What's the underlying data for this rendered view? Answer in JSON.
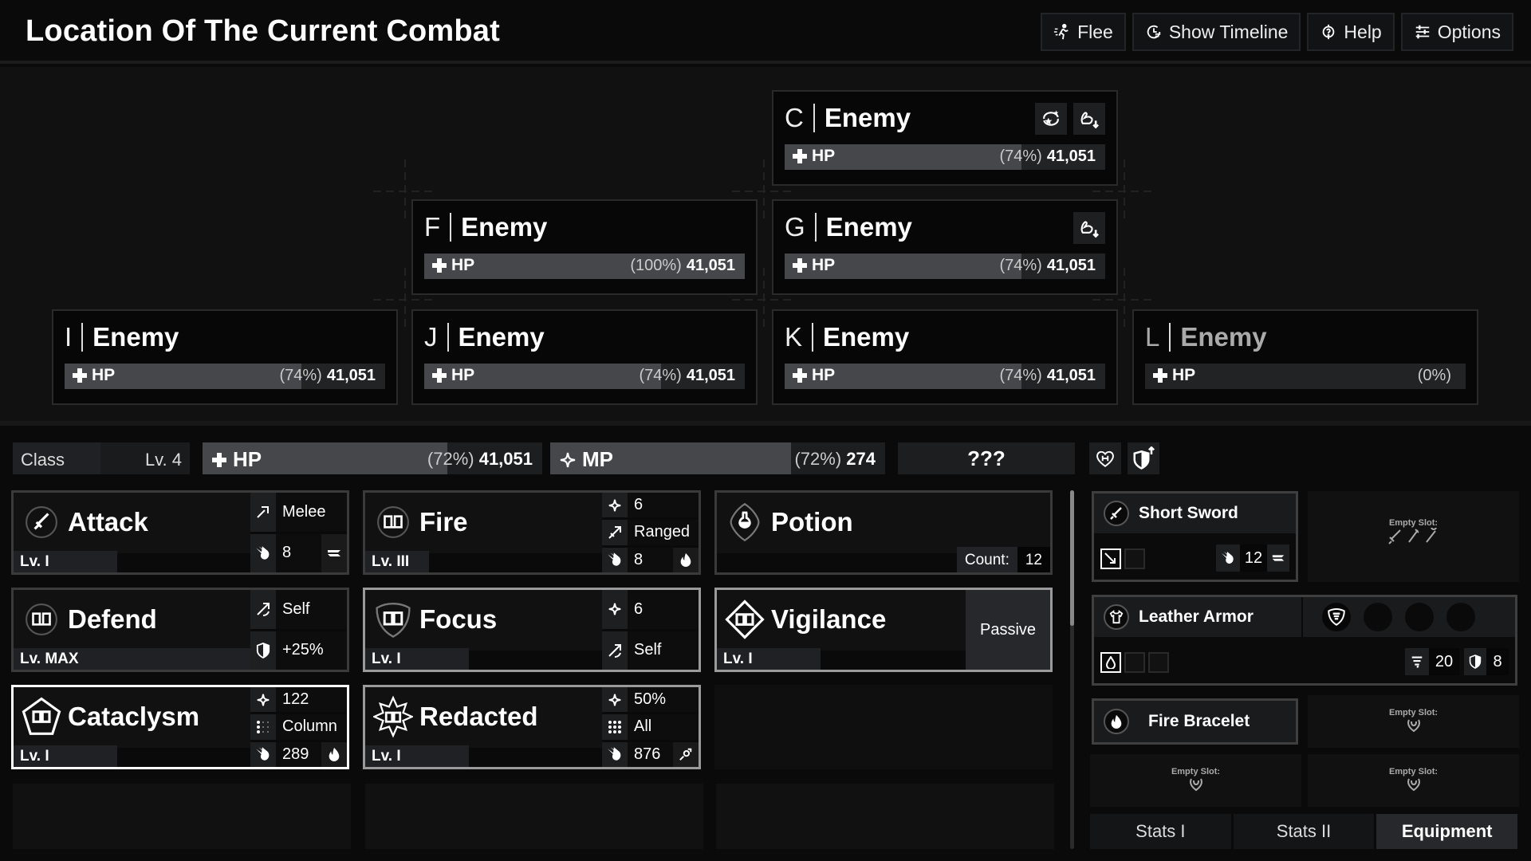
{
  "header": {
    "title": "Location Of The Current Combat",
    "buttons": [
      {
        "label": "Flee",
        "icon": "running-person-icon"
      },
      {
        "label": "Show Timeline",
        "icon": "timeline-clock-icon"
      },
      {
        "label": "Help",
        "icon": "help-icon"
      },
      {
        "label": "Options",
        "icon": "sliders-icon"
      }
    ]
  },
  "enemies": [
    {
      "letter": "C",
      "name": "Enemy",
      "hp_label": "HP",
      "hp_pct_text": "(74%)",
      "hp_value": "41,051",
      "hp_fraction": 0.74,
      "status_icons": [
        "star-swirl-icon",
        "strength-down-icon"
      ]
    },
    {
      "letter": "F",
      "name": "Enemy",
      "hp_label": "HP",
      "hp_pct_text": "(100%)",
      "hp_value": "41,051",
      "hp_fraction": 1.0,
      "status_icons": []
    },
    {
      "letter": "G",
      "name": "Enemy",
      "hp_label": "HP",
      "hp_pct_text": "(74%)",
      "hp_value": "41,051",
      "hp_fraction": 0.74,
      "status_icons": [
        "strength-down-icon"
      ]
    },
    {
      "letter": "I",
      "name": "Enemy",
      "hp_label": "HP",
      "hp_pct_text": "(74%)",
      "hp_value": "41,051",
      "hp_fraction": 0.74,
      "status_icons": []
    },
    {
      "letter": "J",
      "name": "Enemy",
      "hp_label": "HP",
      "hp_pct_text": "(74%)",
      "hp_value": "41,051",
      "hp_fraction": 0.74,
      "status_icons": []
    },
    {
      "letter": "K",
      "name": "Enemy",
      "hp_label": "HP",
      "hp_pct_text": "(74%)",
      "hp_value": "41,051",
      "hp_fraction": 0.74,
      "status_icons": []
    },
    {
      "letter": "L",
      "name": "Enemy",
      "hp_label": "HP",
      "hp_pct_text": "(0%)",
      "hp_value": "",
      "hp_fraction": 0.0,
      "status_icons": [],
      "defeated": true
    }
  ],
  "player": {
    "class_label": "Class",
    "level": "Lv. 4",
    "hp": {
      "label": "HP",
      "pct_text": "(72%)",
      "value": "41,051",
      "fraction": 0.72
    },
    "mp": {
      "label": "MP",
      "pct_text": "(72%)",
      "value": "274",
      "fraction": 0.72
    },
    "unknown": "???",
    "status_icons": [
      "heart-shield-icon",
      "defense-up-icon"
    ]
  },
  "abilities": [
    {
      "name": "Attack",
      "level": "Lv. I",
      "icon": "sword-icon",
      "stats": [
        {
          "icon": "melee-icon",
          "value": "Melee"
        },
        {
          "icon": "claw-damage-icon",
          "value": "8",
          "extra": "slash-type-icon"
        }
      ]
    },
    {
      "name": "Fire",
      "level": "Lv. III",
      "icon": "spellbook-icon",
      "stats": [
        {
          "icon": "mp-cost-icon",
          "value": "6"
        },
        {
          "icon": "ranged-icon",
          "value": "Ranged"
        },
        {
          "icon": "claw-damage-icon",
          "value": "8",
          "extra": "fire-element-icon"
        }
      ]
    },
    {
      "name": "Potion",
      "icon": "potion-icon",
      "count_label": "Count:",
      "count": "12"
    },
    {
      "name": "Defend",
      "level": "Lv. MAX",
      "icon": "spellbook-icon",
      "stats": [
        {
          "icon": "self-target-icon",
          "value": "Self"
        },
        {
          "icon": "shield-icon",
          "value": "+25%"
        }
      ]
    },
    {
      "name": "Focus",
      "level": "Lv. I",
      "icon": "spellbook-shield-icon",
      "stats": [
        {
          "icon": "mp-cost-icon",
          "value": "6"
        },
        {
          "icon": "self-target-icon",
          "value": "Self"
        }
      ]
    },
    {
      "name": "Vigilance",
      "level": "Lv. I",
      "icon": "spellbook-diamond-icon",
      "passive_label": "Passive"
    },
    {
      "name": "Cataclysm",
      "level": "Lv. I",
      "icon": "spellbook-pentagon-icon",
      "stats": [
        {
          "icon": "mp-cost-icon",
          "value": "122"
        },
        {
          "icon": "column-area-icon",
          "value": "Column"
        },
        {
          "icon": "claw-damage-icon",
          "value": "289",
          "extra": "fire-element-icon"
        }
      ]
    },
    {
      "name": "Redacted",
      "level": "Lv. I",
      "icon": "spellbook-star-icon",
      "stats": [
        {
          "icon": "mp-cost-icon",
          "value": "50%"
        },
        {
          "icon": "all-area-icon",
          "value": "All"
        },
        {
          "icon": "claw-damage-icon",
          "value": "876",
          "extra": "pierce-type-icon"
        }
      ]
    }
  ],
  "equipment": {
    "weapon": {
      "name": "Short Sword",
      "damage": "12"
    },
    "weapon_empty": {
      "label": "Empty Slot:"
    },
    "armor": {
      "name": "Leather Armor",
      "resist": "20",
      "defense": "8"
    },
    "accessory": {
      "name": "Fire Bracelet"
    },
    "empty_slot_label": "Empty Slot:"
  },
  "tabs": [
    {
      "label": "Stats I",
      "active": false
    },
    {
      "label": "Stats II",
      "active": false
    },
    {
      "label": "Equipment",
      "active": true
    }
  ]
}
